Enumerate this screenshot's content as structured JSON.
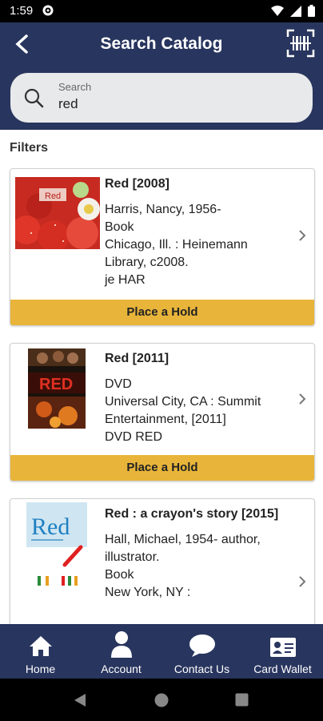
{
  "status_bar": {
    "time": "1:59"
  },
  "header": {
    "title": "Search Catalog"
  },
  "search": {
    "label": "Search",
    "value": "red"
  },
  "filters_label": "Filters",
  "results": [
    {
      "title": "Red [2008]",
      "lines": [
        "Harris, Nancy, 1956-",
        "Book",
        "Chicago, Ill. : Heinemann Library, c2008.",
        "je HAR"
      ],
      "hold_label": "Place a Hold",
      "cover_text": "Red"
    },
    {
      "title": "Red [2011]",
      "lines": [
        "DVD",
        "Universal City, CA : Summit Entertainment, [2011]",
        "DVD RED"
      ],
      "hold_label": "Place a Hold",
      "cover_text": "RED"
    },
    {
      "title": "Red : a crayon's story [2015]",
      "lines": [
        "Hall, Michael, 1954- author, illustrator.",
        "Book",
        "New York, NY :"
      ],
      "cover_text": "Red"
    }
  ],
  "bottom_nav": [
    {
      "label": "Home",
      "icon": "home-icon"
    },
    {
      "label": "Account",
      "icon": "person-icon"
    },
    {
      "label": "Contact Us",
      "icon": "chat-icon"
    },
    {
      "label": "Card Wallet",
      "icon": "card-icon"
    }
  ],
  "colors": {
    "header": "#28355e",
    "hold": "#e8b53a"
  }
}
